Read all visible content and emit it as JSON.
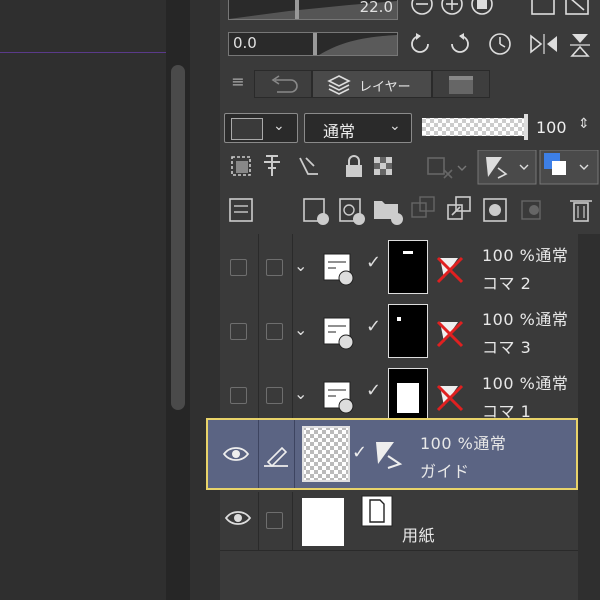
{
  "top_controls": {
    "brush_size_value": "22.0",
    "opacity_value": "0.0"
  },
  "tabs": [
    {
      "label": "",
      "icon": "undo-history-icon"
    },
    {
      "label": "レイヤー",
      "icon": "layers-icon"
    },
    {
      "label": "",
      "icon": "clapperboard-icon"
    }
  ],
  "layer_panel": {
    "blend_mode": "通常",
    "opacity_percent": "100"
  },
  "layers": [
    {
      "name": "コマ 2",
      "info": "100 %通常",
      "visible": false,
      "type": "frame-folder"
    },
    {
      "name": "コマ 3",
      "info": "100 %通常",
      "visible": false,
      "type": "frame-folder"
    },
    {
      "name": "コマ 1",
      "info": "100 %通常",
      "visible": false,
      "type": "frame-folder"
    },
    {
      "name": "ガイド",
      "info": "100 %通常",
      "visible": true,
      "selected": true,
      "type": "guide"
    },
    {
      "name": "用紙",
      "info": "",
      "visible": true,
      "type": "paper"
    }
  ],
  "colors": {
    "selected_row": "#5b6483",
    "selection_border": "#e8d36a",
    "accent_blue": "#3d7fe6",
    "mask_red": "#e02020"
  }
}
